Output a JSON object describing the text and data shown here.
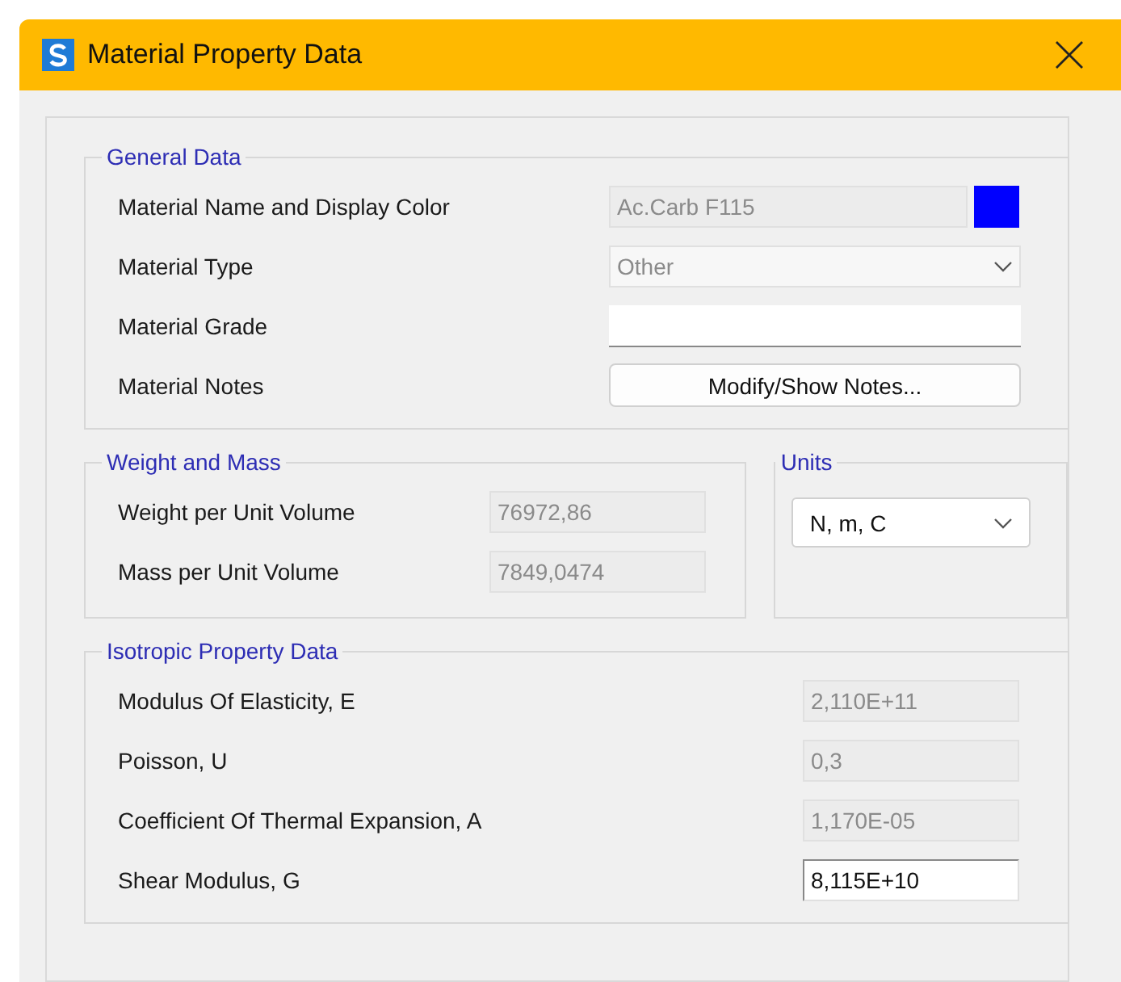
{
  "window": {
    "title": "Material Property Data"
  },
  "general_data": {
    "title": "General Data",
    "rows": [
      {
        "label": "Material Name and Display Color",
        "kind": "name_color",
        "value": "Ac.Carb F115",
        "disabled": true,
        "color": "#0000ff"
      },
      {
        "label": "Material Type",
        "kind": "dropdown",
        "value": "Other",
        "disabled": true
      },
      {
        "label": "Material Grade",
        "kind": "text",
        "disabled": false
      },
      {
        "label": "Material Notes",
        "kind": "button",
        "button": "Modify/Show Notes..."
      }
    ]
  },
  "weight_and_mass": {
    "title": "Weight and Mass",
    "rows": [
      {
        "label": "Weight per Unit Volume",
        "kind": "text",
        "value": "76972,86",
        "disabled": true
      },
      {
        "label": "Mass per Unit Volume",
        "kind": "text",
        "value": "7849,0474",
        "disabled": true
      }
    ]
  },
  "units": {
    "title": "Units",
    "value": "N, m, C",
    "disabled": false
  },
  "isotropic_property_data": {
    "title": "Isotropic Property Data",
    "rows": [
      {
        "label": "Modulus Of Elasticity,  E",
        "kind": "text",
        "value": "2,110E+11",
        "disabled": true
      },
      {
        "label": "Poisson, U",
        "kind": "text",
        "value": "0,3",
        "disabled": true
      },
      {
        "label": "Coefficient Of Thermal Expansion,  A",
        "kind": "text",
        "value": "1,170E-05",
        "disabled": true
      },
      {
        "label": "Shear Modulus,  G",
        "kind": "text",
        "value": "8,115E+10",
        "disabled": false
      }
    ]
  }
}
